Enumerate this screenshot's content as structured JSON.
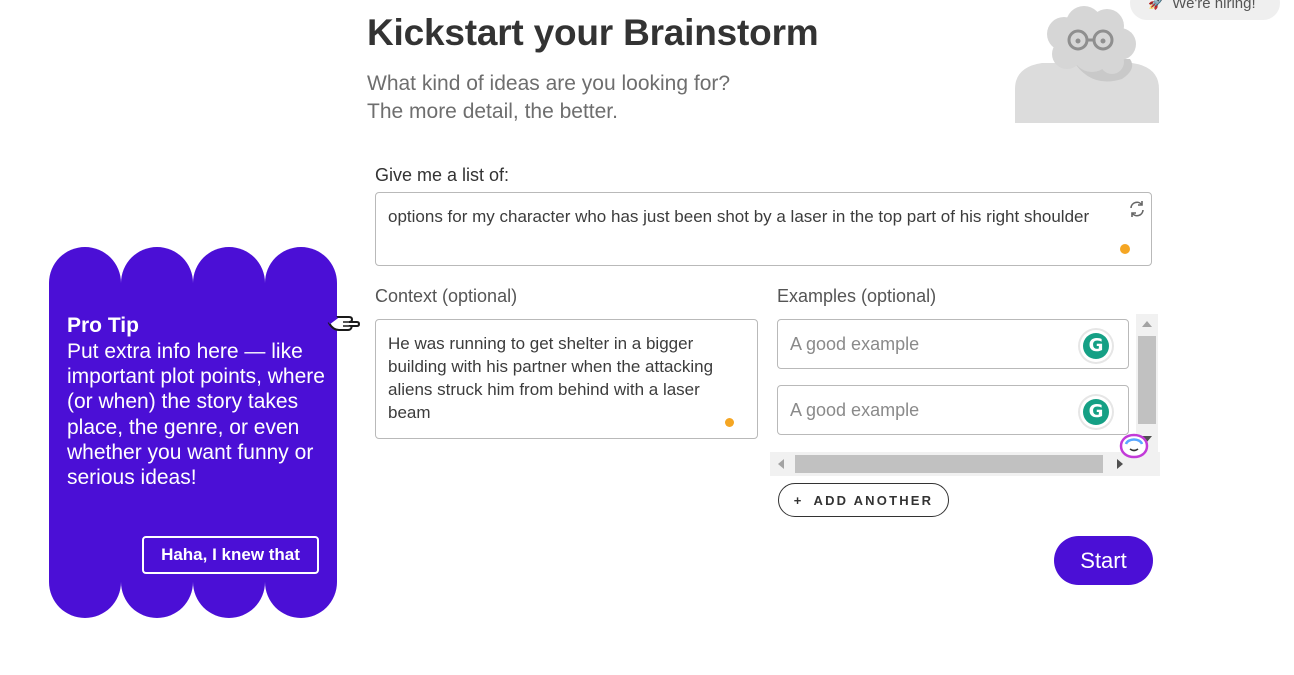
{
  "hiring_badge": {
    "label": "We're hiring!",
    "icon": "rocket-icon"
  },
  "header": {
    "title": "Kickstart your Brainstorm",
    "subtitle_line1": "What kind of ideas are you looking for?",
    "subtitle_line2": "The more detail, the better."
  },
  "list": {
    "label": "Give me a list of:",
    "value": "options for my character who has just been shot by a laser in the top part of his right shoulder"
  },
  "context": {
    "label": "Context (optional)",
    "value": "He was running to get shelter in a bigger building with his partner when the attacking aliens struck him from behind with a laser beam"
  },
  "examples": {
    "label": "Examples (optional)",
    "items": [
      {
        "placeholder": "A good example"
      },
      {
        "placeholder": "A good example"
      }
    ],
    "add_label": "ADD ANOTHER",
    "add_icon": "+"
  },
  "start_label": "Start",
  "protip": {
    "heading": "Pro Tip",
    "body": "Put extra info here — like important plot points, where (or when) the story takes place, the genre, or even whether you want funny or serious ideas!",
    "dismiss_label": "Haha, I knew that"
  },
  "colors": {
    "accent": "#4b0fd6",
    "dot": "#f5a623",
    "grammarly": "#15a085"
  }
}
